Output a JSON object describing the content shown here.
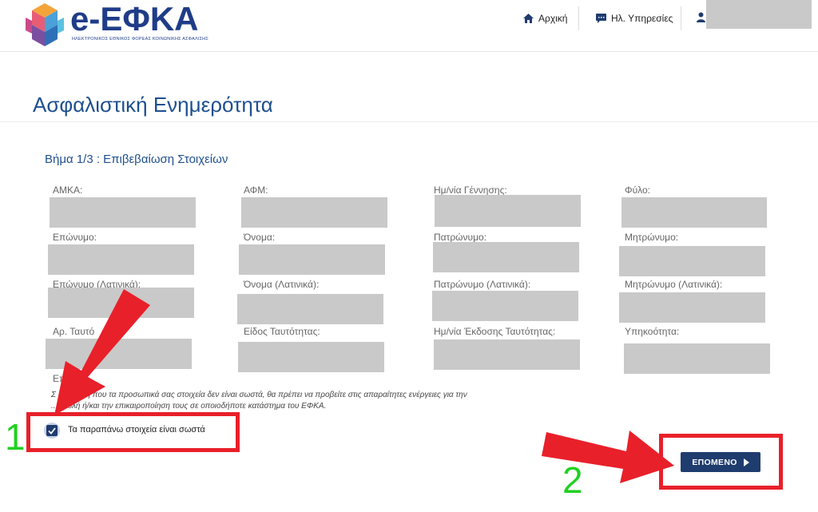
{
  "header": {
    "logo_text": "e-ΕΦΚΑ",
    "logo_subtitle": "ΗΛΕΚΤΡΟΝΙΚΟΣ ΕΘΝΙΚΟΣ ΦΟΡΕΑΣ ΚΟΙΝΩΝΙΚΗΣ ΑΣΦΑΛΙΣΗΣ",
    "nav": {
      "home": "Αρχική",
      "services": "Ηλ. Υπηρεσίες"
    }
  },
  "page": {
    "title": "Ασφαλιστική Ενημερότητα",
    "step_title": "Βήμα 1/3 : Επιβεβαίωση Στοιχείων"
  },
  "fields": {
    "amka": "ΑΜΚΑ:",
    "afm": "ΑΦΜ:",
    "birth_date": "Ημ/νία Γέννησης:",
    "gender": "Φύλο:",
    "surname": "Επώνυμο:",
    "name": "Όνομα:",
    "father_name": "Πατρώνυμο:",
    "mother_name": "Μητρώνυμο:",
    "surname_latin": "Επώνυμο (Λατινικά):",
    "name_latin": "Όνομα (Λατινικά):",
    "father_name_latin": "Πατρώνυμο (Λατινικά):",
    "mother_name_latin": "Μητρώνυμο (Λατινικά):",
    "id_number": "Αρ. Ταυτό",
    "id_type": "Είδος Ταυτότητας:",
    "id_issue_date": "Ημ/νία Έκδοσης Ταυτότητας:",
    "citizenship": "Υπηκοότητα:",
    "other_partial": "Επ"
  },
  "notice": {
    "line1": "Σ ...ίπτωση που τα προσωπικά σας στοιχεία δεν είναι σωστά, θα πρέπει να προβείτε στις απαραίτητες ενέργειες για την",
    "line2": "...ηπολή ή/και την επικαιροποίηση τους σε οποιοδήποτε κατάστημα του ΕΦΚΑ."
  },
  "confirm": {
    "label": "Τα παραπάνω στοιχεία είναι σωστά",
    "checked": true
  },
  "actions": {
    "next_label": "ΕΠΟΜΕΝΟ"
  },
  "annotations": {
    "step1": "1",
    "step2": "2",
    "arrow_color": "#e8202a",
    "number_color": "#22d022"
  }
}
